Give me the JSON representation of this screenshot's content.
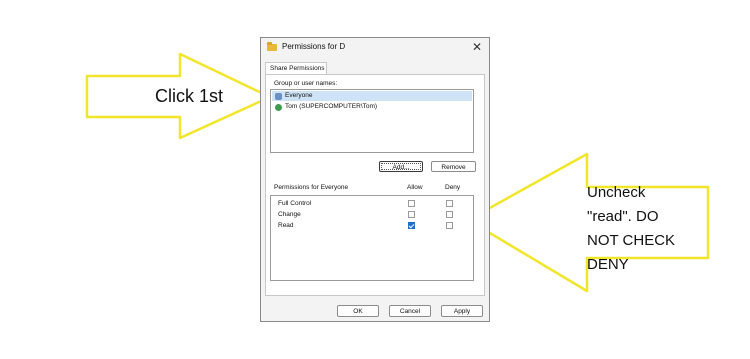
{
  "dialog": {
    "title": "Permissions for D",
    "close_glyph": "✕",
    "tab_label": "Share Permissions",
    "group_label": "Group or user names:",
    "users": [
      {
        "name": "Everyone",
        "icon": "group-icon",
        "selected": true
      },
      {
        "name": "Tom (SUPERCOMPUTER\\Tom)",
        "icon": "user-icon",
        "selected": false
      }
    ],
    "add_label": "Add...",
    "remove_label": "Remove",
    "permissions_label": "Permissions for Everyone",
    "allow_header": "Allow",
    "deny_header": "Deny",
    "permissions": [
      {
        "name": "Full Control",
        "allow": false,
        "deny": false
      },
      {
        "name": "Change",
        "allow": false,
        "deny": false
      },
      {
        "name": "Read",
        "allow": true,
        "deny": false
      }
    ],
    "ok_label": "OK",
    "cancel_label": "Cancel",
    "apply_label": "Apply"
  },
  "annotations": {
    "left_text": "Click 1st",
    "right_lines": [
      "Uncheck",
      "\"read\". DO",
      "NOT CHECK",
      "DENY"
    ],
    "color": "#f2e62a"
  }
}
